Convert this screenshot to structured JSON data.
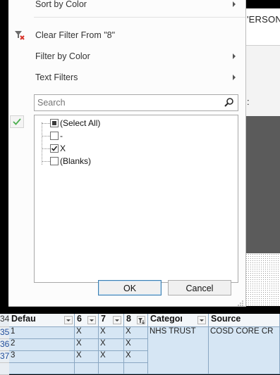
{
  "sheet": {
    "header_fragment": "'ERSON",
    "colon_fragment": ":"
  },
  "menu": {
    "sort_by_color": "Sort by Color",
    "clear_filter": "Clear Filter From \"8\"",
    "filter_by_color": "Filter by Color",
    "text_filters": "Text Filters"
  },
  "search": {
    "placeholder": "Search"
  },
  "filter_list": [
    {
      "label": "(Select All)",
      "state": "indeterminate"
    },
    {
      "label": "-",
      "state": "unchecked"
    },
    {
      "label": "X",
      "state": "checked"
    },
    {
      "label": "(Blanks)",
      "state": "unchecked"
    }
  ],
  "buttons": {
    "ok": "OK",
    "cancel": "Cancel"
  },
  "grid": {
    "header_row_number": "34",
    "columns": [
      "Defau",
      "6",
      "7",
      "8",
      "Categoı",
      "Source"
    ],
    "rows": [
      {
        "num": "35",
        "cells": [
          "1",
          "X",
          "X",
          "X",
          "NHS TRUST",
          "COSD CORE CR"
        ]
      },
      {
        "num": "36",
        "cells": [
          "2",
          "X",
          "X",
          "X",
          "",
          ""
        ]
      },
      {
        "num": "37",
        "cells": [
          "3",
          "X",
          "X",
          "X",
          "",
          ""
        ]
      }
    ]
  },
  "colors": {
    "accent": "#3c7fb1",
    "check_green": "#4caf50",
    "filter_red": "#d9342b",
    "row_number_blue": "#1f4e9c"
  }
}
